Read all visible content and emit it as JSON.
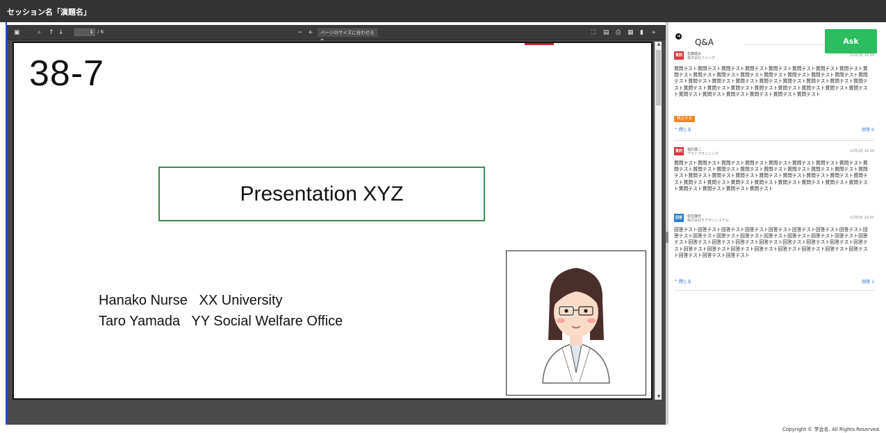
{
  "header": {
    "title": "セッション名「演題名」"
  },
  "pdf_toolbar": {
    "page_current": "1",
    "page_total": "/ 6",
    "zoom_minus": "−",
    "zoom_plus": "+",
    "zoom_label": "ページのサイズに合わせる ≑",
    "more": "»"
  },
  "slide": {
    "number": "38-7",
    "title": "Presentation XYZ",
    "author_line_1": "Hanako Nurse   XX University",
    "author_line_2": "Taro Yamada   YY Social Welfare Office"
  },
  "qa": {
    "title": "Q&A",
    "ask_label": "Ask",
    "items": [
      {
        "badge": "質問",
        "name": "佐藤健太",
        "org": "株式会社ファング",
        "date": "11月2日 10:10",
        "text": "質問テスト質問テスト質問テスト質問テスト質問テスト質問テスト質問テスト質問テスト質問テスト質問テスト質問テスト質問テスト質問テスト質問テスト質問テスト質問テスト質問テスト質問テスト質問テスト質問テスト質問テスト質問テスト質問テスト質問テスト質問テスト質問テスト質問テスト質問テスト質問テスト質問テスト質問テスト質問テスト質問テスト質問テスト質問テスト質問テスト質問テスト質問テスト質問テスト",
        "edit_label": "修正する",
        "close_label": "^ 閉じる",
        "answer_count": "回答 0"
      },
      {
        "badge": "質問",
        "name": "福村勇二",
        "org": "アウトプランニング",
        "date": "11月2日 10:10",
        "text": "質問テスト質問テスト質問テスト質問テスト質問テスト質問テスト質問テスト質問テスト質問テスト質問テスト質問テスト質問テスト質問テスト質問テスト質問テスト質問テスト質問テスト質問テスト質問テスト質問テスト質問テスト質問テスト質問テスト質問テスト質問テスト質問テスト質問テスト質問テスト質問テスト質問テスト質問テスト質問テスト質問テスト質問テスト質問テスト質問テスト質問テスト"
      },
      {
        "badge": "回答",
        "name": "佐伯優也",
        "org": "株式会社モアザンシステム",
        "date": "11月5日 20:45",
        "text": "回答テスト回答テスト回答テスト回答テスト回答テスト回答テスト回答テスト回答テスト回答テスト回答テスト回答テスト回答テスト回答テスト回答テスト回答テスト回答テスト回答テスト回答テスト回答テスト回答テスト回答テスト回答テスト回答テスト回答テスト回答テスト回答テスト回答テスト回答テスト回答テスト回答テスト回答テスト回答テスト回答テスト回答テスト回答テスト回答テスト",
        "close_label": "^ 閉じる",
        "answer_count": "回答 1"
      }
    ]
  },
  "footer": {
    "copyright": "Copyright © 学会名. All Rights Reserved."
  },
  "colors": {
    "ask": "#2bbd5e",
    "question_badge": "#d9363e",
    "answer_badge": "#2a7fd4",
    "edit": "#f0861f",
    "title_border": "#3b8a4f"
  },
  "icons": [
    "sidebar-toggle-icon",
    "search-icon",
    "arrow-up-icon",
    "arrow-down-icon",
    "presentation-icon",
    "open-file-icon",
    "print-icon",
    "download-icon",
    "bookmark-icon",
    "more-tools-icon",
    "back-circle-icon"
  ]
}
